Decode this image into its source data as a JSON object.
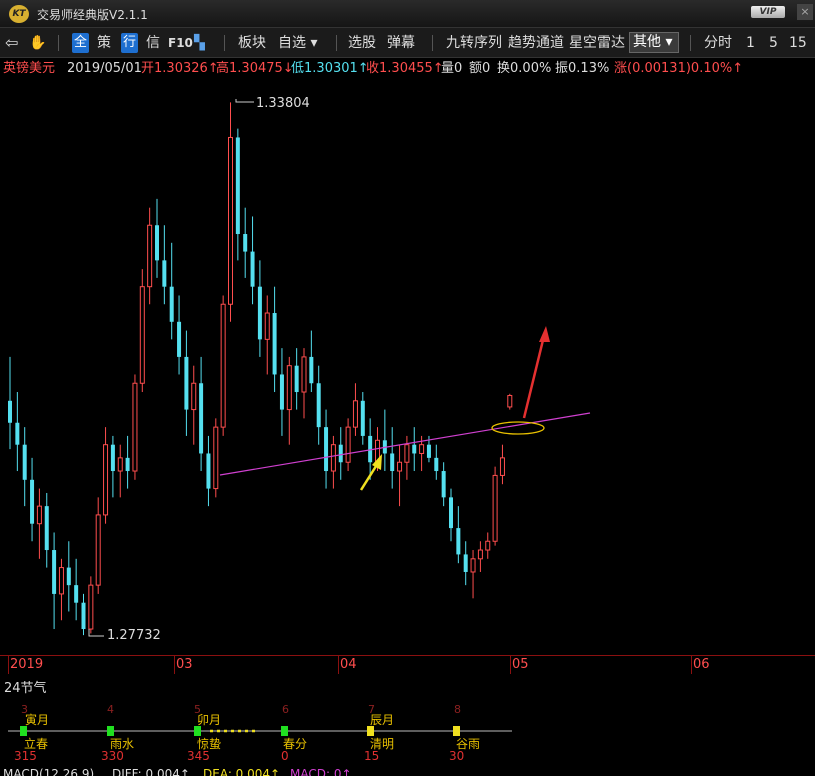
{
  "titlebar": {
    "logo": "KT",
    "title": "交易师经典版V2.1.1",
    "vip": "VIP",
    "close": "×"
  },
  "toolbar": {
    "back": "⇦",
    "hand": "✋",
    "all": "全",
    "strategy": "策",
    "row": "行",
    "info": "信",
    "f10": "F10",
    "layout": "▚",
    "sector": "板块",
    "watchlist": "自选 ▾",
    "stock_pick": "选股",
    "popup": "弹幕",
    "nine_turn": "九转序列",
    "trend_channel": "趋势通道",
    "star_radar": "星空雷达",
    "other": "其他 ▾",
    "intraday": "分时",
    "p1": "1",
    "p5": "5",
    "p15": "15"
  },
  "info": {
    "symbol": "英镑美元",
    "date": "2019/05/01",
    "open_label": "开",
    "open": "1.30326↑",
    "high_label": "高",
    "high": "1.30475↓",
    "low_label": "低",
    "low": "1.30301↑",
    "close_label": "收",
    "close": "1.30455↑",
    "vol_label": "量",
    "vol": "0",
    "amt_label": "额",
    "amt": "0",
    "turnover_label": "换",
    "turnover": "0.00%",
    "amp_label": "振",
    "amp": "0.13%",
    "chg_label": "涨",
    "chg": "(0.00131)0.10%↑"
  },
  "chart_data": {
    "type": "candlestick",
    "title": "",
    "annotations": {
      "max": "1.33804",
      "min": "1.27732"
    },
    "x_labels": [
      "2019",
      "03",
      "04",
      "05",
      "06"
    ],
    "colors": {
      "up": "#ff4e4e",
      "down": "#55e0f0",
      "trendline": "#d040d0",
      "arrow_up": "#e53030",
      "arrow_yellow": "#f0e020",
      "ellipse": "#e8c000"
    },
    "candles": [
      [
        1.304,
        1.309,
        1.2985,
        1.3015
      ],
      [
        1.3015,
        1.305,
        1.296,
        1.299
      ],
      [
        1.299,
        1.301,
        1.292,
        1.295
      ],
      [
        1.295,
        1.2975,
        1.288,
        1.29
      ],
      [
        1.29,
        1.294,
        1.286,
        1.292
      ],
      [
        1.292,
        1.2935,
        1.285,
        1.287
      ],
      [
        1.287,
        1.289,
        1.278,
        1.282
      ],
      [
        1.282,
        1.286,
        1.279,
        1.285
      ],
      [
        1.285,
        1.288,
        1.28,
        1.283
      ],
      [
        1.283,
        1.286,
        1.279,
        1.281
      ],
      [
        1.281,
        1.282,
        1.2773,
        1.278
      ],
      [
        1.278,
        1.284,
        1.2775,
        1.283
      ],
      [
        1.283,
        1.293,
        1.282,
        1.291
      ],
      [
        1.291,
        1.301,
        1.29,
        1.299
      ],
      [
        1.299,
        1.3,
        1.293,
        1.296
      ],
      [
        1.296,
        1.299,
        1.293,
        1.2975
      ],
      [
        1.2975,
        1.3,
        1.294,
        1.296
      ],
      [
        1.296,
        1.307,
        1.295,
        1.306
      ],
      [
        1.306,
        1.319,
        1.305,
        1.317
      ],
      [
        1.317,
        1.326,
        1.315,
        1.324
      ],
      [
        1.324,
        1.327,
        1.318,
        1.32
      ],
      [
        1.32,
        1.324,
        1.315,
        1.317
      ],
      [
        1.317,
        1.322,
        1.311,
        1.313
      ],
      [
        1.313,
        1.316,
        1.307,
        1.309
      ],
      [
        1.309,
        1.312,
        1.3,
        1.303
      ],
      [
        1.303,
        1.308,
        1.299,
        1.306
      ],
      [
        1.306,
        1.309,
        1.296,
        1.298
      ],
      [
        1.298,
        1.3,
        1.292,
        1.294
      ],
      [
        1.294,
        1.302,
        1.293,
        1.301
      ],
      [
        1.301,
        1.316,
        1.3,
        1.315
      ],
      [
        1.315,
        1.338,
        1.313,
        1.334
      ],
      [
        1.334,
        1.335,
        1.32,
        1.323
      ],
      [
        1.323,
        1.326,
        1.318,
        1.321
      ],
      [
        1.321,
        1.325,
        1.315,
        1.317
      ],
      [
        1.317,
        1.32,
        1.309,
        1.311
      ],
      [
        1.311,
        1.316,
        1.307,
        1.314
      ],
      [
        1.314,
        1.317,
        1.305,
        1.307
      ],
      [
        1.307,
        1.31,
        1.3,
        1.303
      ],
      [
        1.303,
        1.309,
        1.299,
        1.308
      ],
      [
        1.308,
        1.31,
        1.303,
        1.305
      ],
      [
        1.305,
        1.31,
        1.302,
        1.309
      ],
      [
        1.309,
        1.312,
        1.305,
        1.306
      ],
      [
        1.306,
        1.308,
        1.299,
        1.301
      ],
      [
        1.301,
        1.303,
        1.294,
        1.296
      ],
      [
        1.296,
        1.3,
        1.294,
        1.299
      ],
      [
        1.299,
        1.301,
        1.295,
        1.297
      ],
      [
        1.297,
        1.302,
        1.296,
        1.301
      ],
      [
        1.301,
        1.306,
        1.3,
        1.304
      ],
      [
        1.304,
        1.305,
        1.299,
        1.3
      ],
      [
        1.3,
        1.302,
        1.295,
        1.297
      ],
      [
        1.297,
        1.301,
        1.296,
        1.2995
      ],
      [
        1.2995,
        1.303,
        1.296,
        1.298
      ],
      [
        1.298,
        1.301,
        1.294,
        1.296
      ],
      [
        1.296,
        1.299,
        1.292,
        1.297
      ],
      [
        1.297,
        1.3,
        1.295,
        1.299
      ],
      [
        1.299,
        1.301,
        1.296,
        1.298
      ],
      [
        1.298,
        1.3,
        1.296,
        1.299
      ],
      [
        1.299,
        1.3,
        1.297,
        1.2975
      ],
      [
        1.2975,
        1.299,
        1.295,
        1.296
      ],
      [
        1.296,
        1.297,
        1.292,
        1.293
      ],
      [
        1.293,
        1.294,
        1.288,
        1.2895
      ],
      [
        1.2895,
        1.292,
        1.2855,
        1.2865
      ],
      [
        1.2865,
        1.288,
        1.283,
        1.2845
      ],
      [
        1.2845,
        1.287,
        1.2815,
        1.286
      ],
      [
        1.286,
        1.288,
        1.2845,
        1.287
      ],
      [
        1.287,
        1.289,
        1.286,
        1.288
      ],
      [
        1.288,
        1.2965,
        1.2875,
        1.2955
      ],
      [
        1.2955,
        1.299,
        1.2945,
        1.2975
      ],
      [
        1.3033,
        1.3048,
        1.303,
        1.3046
      ]
    ]
  },
  "jieqi": {
    "title": "24节气",
    "months": [
      {
        "num": "3",
        "name": "寅月"
      },
      {
        "num": "4",
        "name": ""
      },
      {
        "num": "5",
        "name": "卯月"
      },
      {
        "num": "6",
        "name": ""
      },
      {
        "num": "7",
        "name": "辰月"
      },
      {
        "num": "8",
        "name": ""
      }
    ],
    "terms": [
      {
        "name": "立春",
        "val": "315"
      },
      {
        "name": "雨水",
        "val": "330"
      },
      {
        "name": "惊蛰",
        "val": "345"
      },
      {
        "name": "春分",
        "val": "0"
      },
      {
        "name": "清明",
        "val": "15"
      },
      {
        "name": "谷雨",
        "val": "30"
      }
    ]
  },
  "macd": {
    "label": "MACD(12,26,9)",
    "diff": "DIFF: 0.004↑",
    "dea": "DEA: 0.004↑",
    "macd": "MACD: 0↑"
  }
}
